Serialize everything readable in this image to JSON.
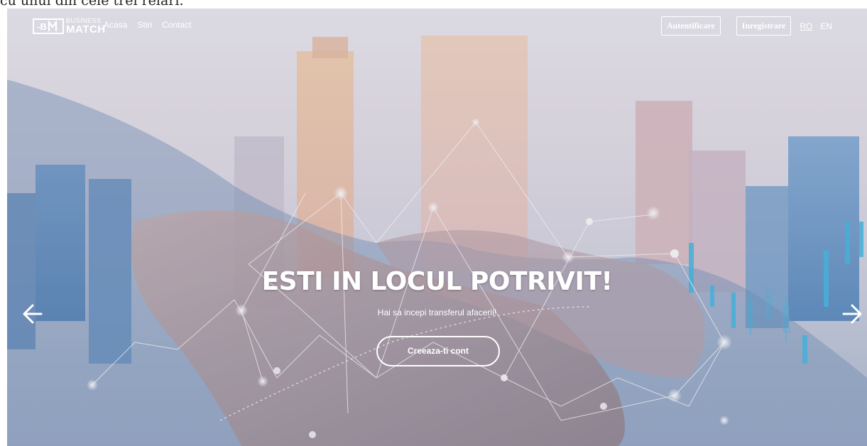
{
  "page_caption": "cu unul din cele trei relari.",
  "logo": {
    "line1": "BUSINESS",
    "line2": "MATCH"
  },
  "nav": {
    "home": "Acasa",
    "news": "Stiri",
    "contact": "Contact"
  },
  "auth": {
    "login": "Autentificare",
    "register": "Inregistrare"
  },
  "languages": [
    {
      "code": "RO",
      "active": true
    },
    {
      "code": "EN",
      "active": false
    }
  ],
  "hero": {
    "headline": "ESTI IN LOCUL POTRIVIT!",
    "subline": "Hai sa incepi transferul afacerii!",
    "cta": "Creeaza-ti cont"
  },
  "icons": {
    "prev": "arrow-left-icon",
    "next": "arrow-right-icon",
    "logo": "bm-logo-icon"
  },
  "colors": {
    "text": "#ffffff",
    "sky": "#e6e3ec",
    "network": "#ffffff",
    "skyline_blue": "#3f86c4"
  }
}
